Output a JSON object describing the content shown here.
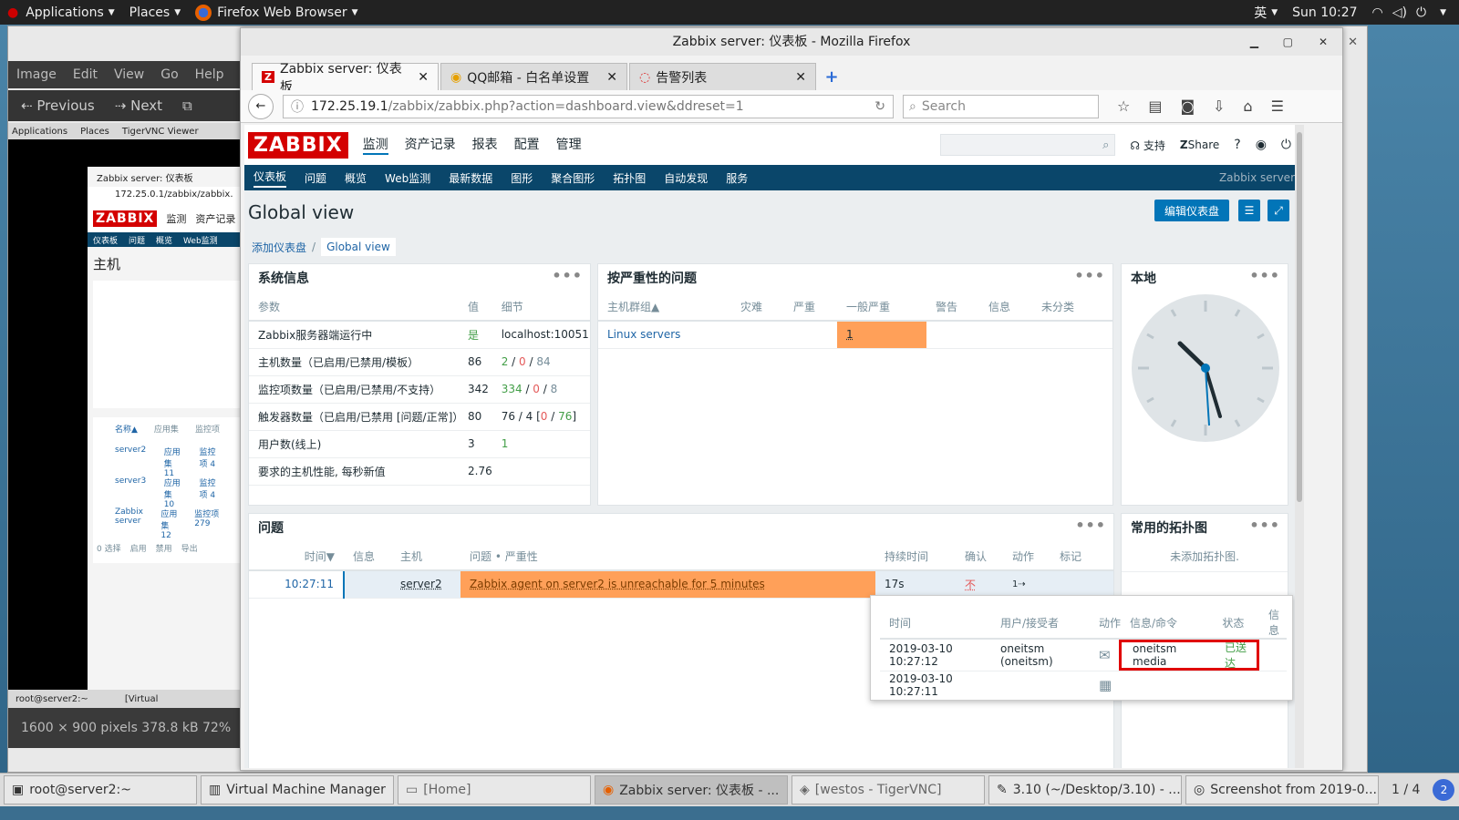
{
  "top_panel": {
    "applications": "Applications",
    "places": "Places",
    "app": "Firefox Web Browser",
    "ime": "英",
    "clock": "Sun 10:27"
  },
  "bg_window": {
    "menu": [
      "Image",
      "Edit",
      "View",
      "Go",
      "Help"
    ],
    "prev": "Previous",
    "next": "Next",
    "status": "1600 × 900 pixels  378.8 kB   72%"
  },
  "bg_inner": {
    "applications": "Applications",
    "places": "Places",
    "vnc": "TigerVNC Viewer",
    "tab": "Zabbix server: 仪表板",
    "url": "172.25.0.1/zabbix/zabbix.",
    "logo": "ZABBIX",
    "nav1": "监测",
    "nav2": "资产记录",
    "sub": [
      "仪表板",
      "问题",
      "概览",
      "Web监测"
    ],
    "heading": "主机",
    "cols": [
      "名称▲",
      "应用集",
      "监控项"
    ],
    "rows": [
      {
        "name": "server2",
        "app": "应用集 11",
        "item": "监控项 4"
      },
      {
        "name": "server3",
        "app": "应用集 10",
        "item": "监控项 4"
      },
      {
        "name": "Zabbix server",
        "app": "应用集 12",
        "item": "监控项 279"
      }
    ],
    "footer": "0 选择",
    "fbtns": [
      "启用",
      "禁用",
      "导出"
    ],
    "task1": "root@server2:~",
    "task2": "[Virtual"
  },
  "firefox": {
    "title": "Zabbix server: 仪表板 - Mozilla Firefox",
    "tabs": [
      {
        "label": "Zabbix server: 仪表板",
        "icon": "Z"
      },
      {
        "label": "QQ邮箱 - 白名单设置",
        "icon": "◉"
      },
      {
        "label": "告警列表",
        "icon": "◌"
      }
    ],
    "url_host": "172.25.19.1",
    "url_path": "/zabbix/zabbix.php?action=dashboard.view&ddreset=1",
    "search_placeholder": "Search"
  },
  "zabbix": {
    "logo": "ZABBIX",
    "mainnav": [
      "监测",
      "资产记录",
      "报表",
      "配置",
      "管理"
    ],
    "support": "支持",
    "share": "Share",
    "subnav": [
      "仪表板",
      "问题",
      "概览",
      "Web监测",
      "最新数据",
      "图形",
      "聚合图形",
      "拓扑图",
      "自动发现",
      "服务"
    ],
    "server_name": "Zabbix server",
    "page_title": "Global view",
    "edit_btn": "编辑仪表盘",
    "breadcrumb": [
      "添加仪表盘",
      "Global view"
    ],
    "sysinfo": {
      "title": "系统信息",
      "headers": [
        "参数",
        "值",
        "细节"
      ],
      "rows": [
        {
          "p": "Zabbix服务器端运行中",
          "v": "是",
          "d": "localhost:10051"
        },
        {
          "p": "主机数量（已启用/已禁用/模板）",
          "v": "86",
          "d1": "2",
          "d2": "0",
          "d3": "84"
        },
        {
          "p": "监控项数量（已启用/已禁用/不支持）",
          "v": "342",
          "d1": "334",
          "d2": "0",
          "d3": "8"
        },
        {
          "p": "触发器数量（已启用/已禁用 [问题/正常]）",
          "v": "80",
          "d0": "76 / 4 [",
          "d1": "0",
          "d3": "76",
          "d4": "]"
        },
        {
          "p": "用户数(线上)",
          "v": "3",
          "d1": "1"
        },
        {
          "p": "要求的主机性能, 每秒新值",
          "v": "2.76"
        }
      ]
    },
    "severity": {
      "title": "按严重性的问题",
      "headers": [
        "主机群组▲",
        "灾难",
        "严重",
        "一般严重",
        "警告",
        "信息",
        "未分类"
      ],
      "group": "Linux servers",
      "avg": "1"
    },
    "clock_title": "本地",
    "problems": {
      "title": "问题",
      "headers": [
        "时间▼",
        "信息",
        "主机",
        "问题 • 严重性",
        "持续时间",
        "确认",
        "动作",
        "标记"
      ],
      "row": {
        "time": "10:27:11",
        "host": "server2",
        "problem": "Zabbix agent on server2 is unreachable for 5 minutes",
        "duration": "17s",
        "ack": "不",
        "actions": "1"
      }
    },
    "maps": {
      "title": "常用的拓扑图",
      "empty": "未添加拓扑图."
    },
    "popup": {
      "headers": [
        "时间",
        "用户/接受者",
        "动作",
        "信息/命令",
        "状态",
        "信息"
      ],
      "rows": [
        {
          "time": "2019-03-10 10:27:12",
          "user": "oneitsm (oneitsm)",
          "msg": "oneitsm media",
          "status": "已送达"
        },
        {
          "time": "2019-03-10 10:27:11"
        }
      ]
    }
  },
  "taskbar": {
    "items": [
      "root@server2:~",
      "Virtual Machine Manager",
      "[Home]",
      "Zabbix server: 仪表板 - ...",
      "[westos - TigerVNC]",
      "3.10 (~/Desktop/3.10) - ...",
      "Screenshot from 2019-0..."
    ],
    "workspace": "1 / 4",
    "badge": "2"
  },
  "colors": {
    "zabbix_red": "#d40000",
    "nav_dark": "#0a466a",
    "accent": "#0275b8",
    "average": "#ffa059",
    "ok_green": "#429e47",
    "problem_red": "#e45959",
    "highlight_box": "#e00000"
  }
}
